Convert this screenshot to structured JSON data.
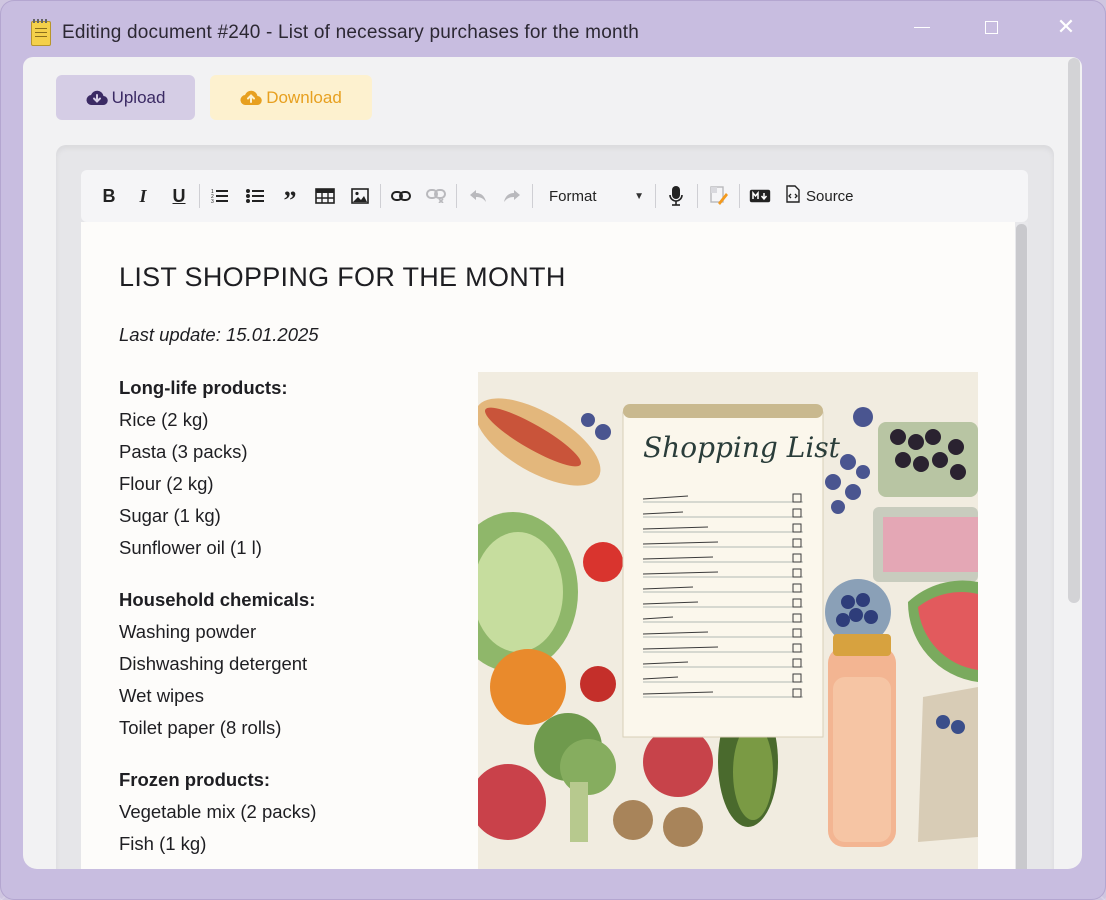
{
  "window": {
    "title": "Editing document #240 - List of necessary purchases for the month"
  },
  "actions": {
    "upload_label": "Upload",
    "download_label": "Download"
  },
  "toolbar": {
    "format_label": "Format",
    "source_label": "Source",
    "icons": [
      "bold-icon",
      "italic-icon",
      "underline-icon",
      "ordered-list-icon",
      "bullet-list-icon",
      "quote-icon",
      "table-icon",
      "image-icon",
      "link-icon",
      "unlink-icon",
      "undo-icon",
      "redo-icon",
      "microphone-icon",
      "highlight-icon",
      "markdown-icon",
      "source-code-icon"
    ]
  },
  "document": {
    "title": "LIST SHOPPING FOR THE MONTH",
    "subtitle": "Last update: 15.01.2025",
    "sections": [
      {
        "heading": "Long-life products:",
        "items": [
          "Rice (2 kg)",
          "Pasta (3 packs)",
          "Flour (2 kg)",
          "Sugar (1 kg)",
          "Sunflower oil (1 l)"
        ]
      },
      {
        "heading": "Household chemicals:",
        "items": [
          "Washing powder",
          "Dishwashing detergent",
          "Wet wipes",
          "Toilet paper (8 rolls)"
        ]
      },
      {
        "heading": "Frozen products:",
        "items": [
          "Vegetable mix (2 packs)",
          "Fish (1 kg)"
        ]
      }
    ],
    "illustration": {
      "heading": "Shopping List"
    }
  },
  "colors": {
    "frame": "#c8bde0",
    "upload_bg": "#d5cde5",
    "upload_text": "#3b2a64",
    "download_bg": "#fdf1cf",
    "download_text": "#e7a020"
  }
}
